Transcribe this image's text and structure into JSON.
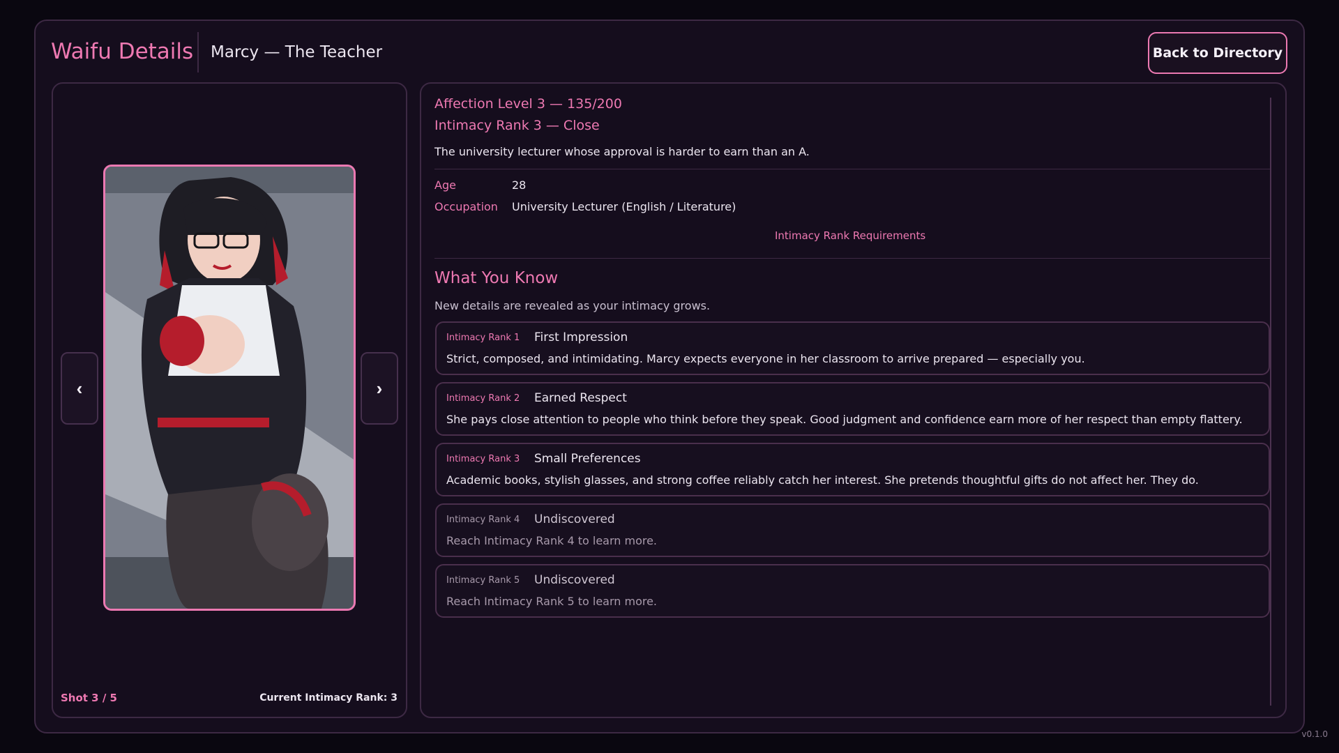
{
  "header": {
    "title": "Waifu Details",
    "subtitle": "Marcy — The Teacher",
    "back_label": "Back to Directory"
  },
  "gallery": {
    "prev_label": "‹",
    "next_label": "›",
    "shot_label": "Shot 3 / 5",
    "rank_label": "Current Intimacy Rank: 3"
  },
  "profile": {
    "affection": "Affection Level 3 — 135/200",
    "intimacy": "Intimacy Rank 3 — Close",
    "description": "The university lecturer whose approval is harder to earn than an A.",
    "age_label": "Age",
    "age_value": "28",
    "occupation_label": "Occupation",
    "occupation_value": "University Lecturer (English / Literature)",
    "requirements_link": "Intimacy Rank Requirements"
  },
  "know": {
    "heading": "What You Know",
    "subheading": "New details are revealed as your intimacy grows.",
    "cards": [
      {
        "tag": "Intimacy Rank 1",
        "title": "First Impression",
        "body": "Strict, composed, and intimidating. Marcy expects everyone in her classroom to arrive prepared — especially you."
      },
      {
        "tag": "Intimacy Rank 2",
        "title": "Earned Respect",
        "body": "She pays close attention to people who think before they speak. Good judgment and confidence earn more of her respect than empty flattery."
      },
      {
        "tag": "Intimacy Rank 3",
        "title": "Small Preferences",
        "body": "Academic books, stylish glasses, and strong coffee reliably catch her interest. She pretends thoughtful gifts do not affect her. They do."
      },
      {
        "tag": "Intimacy Rank 4",
        "title": "Undiscovered",
        "body": "Reach Intimacy Rank 4 to learn more."
      },
      {
        "tag": "Intimacy Rank 5",
        "title": "Undiscovered",
        "body": "Reach Intimacy Rank 5 to learn more."
      }
    ]
  },
  "version": "v0.1.0",
  "colors": {
    "accent": "#ee79b2",
    "background": "#0a0710",
    "panel": "#150d1d",
    "border": "#3d2944"
  }
}
